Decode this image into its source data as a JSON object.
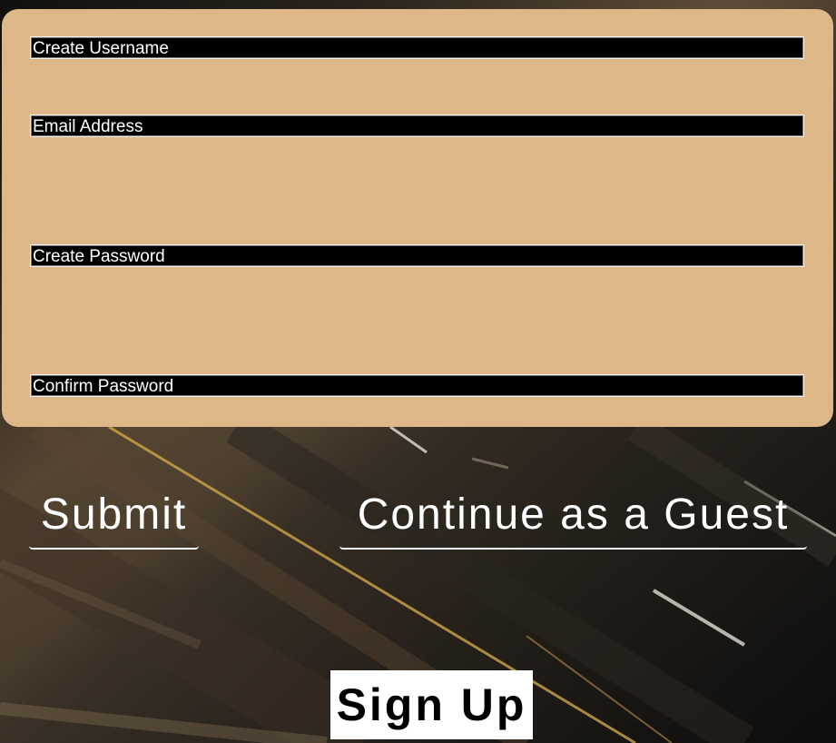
{
  "form": {
    "username_placeholder": "Create Username",
    "email_placeholder": "Email Address",
    "password_placeholder": "Create Password",
    "confirm_placeholder": "Confirm Password"
  },
  "actions": {
    "submit_label": "Submit",
    "guest_label": "Continue as a Guest"
  },
  "footer": {
    "signup_label": "Sign Up"
  },
  "colors": {
    "panel_background": "#ddb787",
    "field_background": "#000000",
    "text_light": "#ffffff",
    "signup_background": "#ffffff"
  }
}
